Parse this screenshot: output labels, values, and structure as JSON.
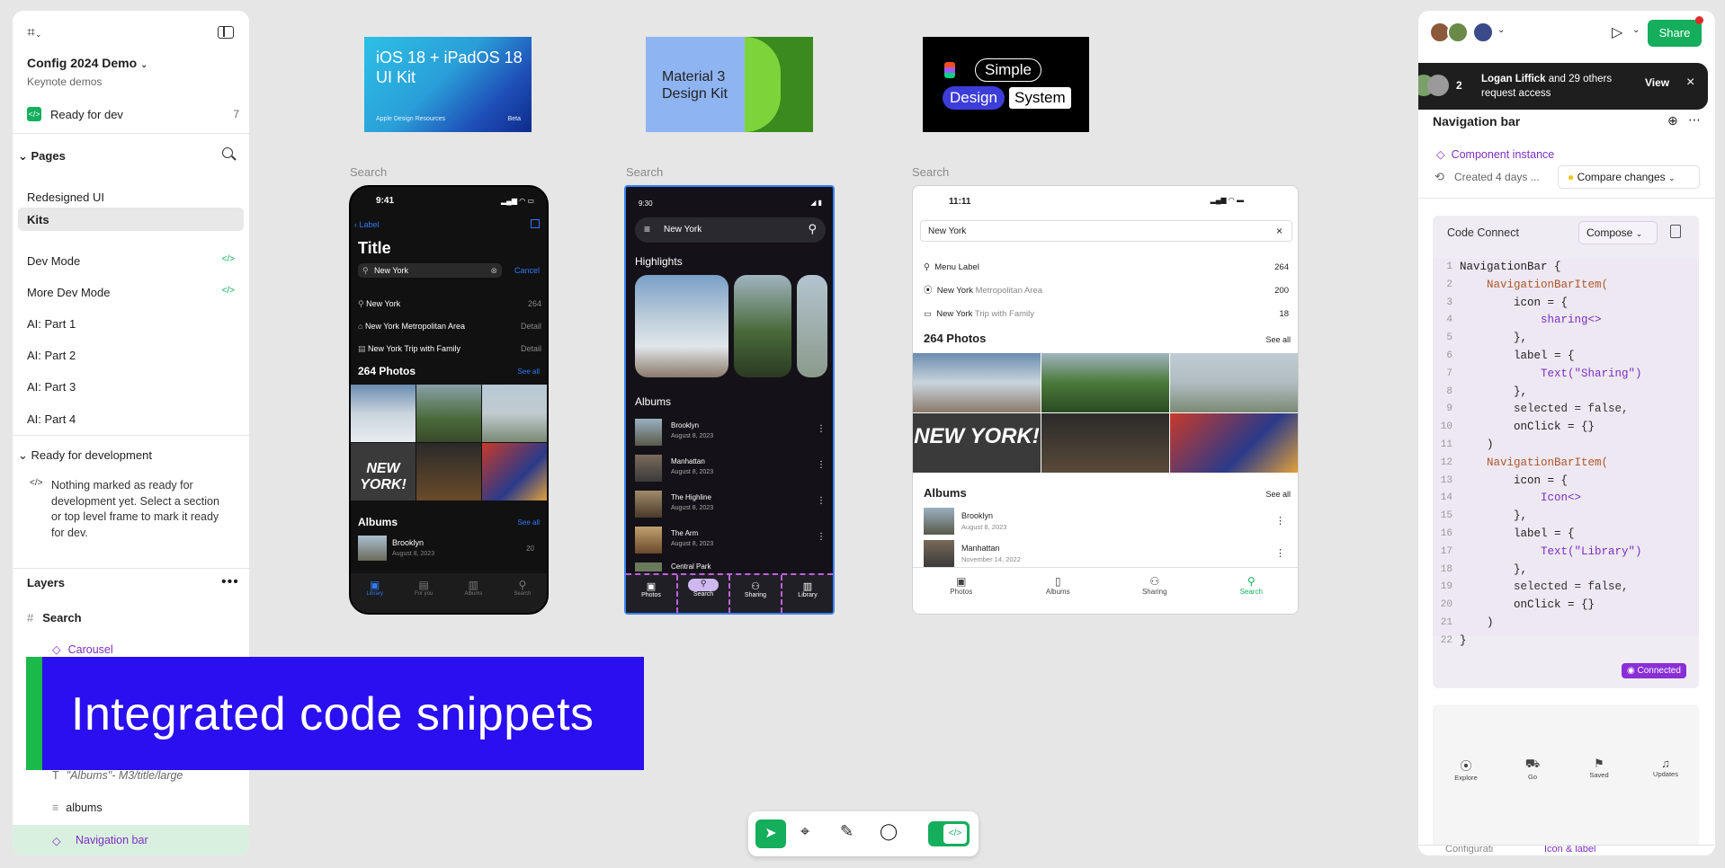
{
  "left": {
    "project_title": "Config 2024 Demo",
    "project_sub": "Keynote demos",
    "ready_label": "Ready for dev",
    "ready_count": "7",
    "pages_header": "Pages",
    "pages": [
      "Redesigned UI",
      "Kits",
      "Dev Mode",
      "More Dev Mode",
      "AI: Part 1",
      "AI: Part 2",
      "AI: Part 3",
      "AI: Part 4"
    ],
    "ready_section": "Ready for development",
    "ready_msg": "Nothing marked as ready for development yet. Select a section or top level frame to mark it ready for dev.",
    "layers_header": "Layers",
    "layers": [
      "Search",
      "Carousel",
      "\"Albums\"- M3/title/large",
      "albums",
      "Navigation bar"
    ]
  },
  "banner": {
    "text": "Integrated code snippets"
  },
  "kits": {
    "ios": {
      "line1": "iOS 18 + iPadOS 18",
      "line2": "UI Kit",
      "foot": "Apple Design Resources",
      "badge": "Beta"
    },
    "material": {
      "line1": "Material 3",
      "line2": "Design Kit"
    },
    "simple": {
      "w1": "Simple",
      "w2": "Design",
      "w3": "System"
    }
  },
  "frame_label": "Search",
  "ios_phone": {
    "time": "9:41",
    "back": "Label",
    "title": "Title",
    "search_value": "New York",
    "cancel": "Cancel",
    "results": [
      {
        "t": "New York",
        "d": "264"
      },
      {
        "t": "New York Metropolitan Area",
        "d": "Detail"
      },
      {
        "t": "New York Trip with Family",
        "d": "Detail"
      }
    ],
    "photos_h": "264 Photos",
    "see_all": "See all",
    "albums_h": "Albums",
    "album1": "Brooklyn",
    "album1_date": "August 8, 2023",
    "album1_count": "20",
    "tabs": [
      "Library",
      "For you",
      "Albums",
      "Search"
    ]
  },
  "m3_phone": {
    "time": "9:30",
    "search_value": "New York",
    "highlights": "Highlights",
    "albums_h": "Albums",
    "albums": [
      {
        "t": "Brooklyn",
        "d": "August 8, 2023"
      },
      {
        "t": "Manhattan",
        "d": "August 8, 2023"
      },
      {
        "t": "The Highline",
        "d": "August 8, 2023"
      },
      {
        "t": "The Arm",
        "d": "August 8, 2023"
      },
      {
        "t": "Central Park",
        "d": ""
      }
    ],
    "nav": [
      "Photos",
      "Search",
      "Sharing",
      "Library"
    ]
  },
  "simple_phone": {
    "time": "11:11",
    "search_value": "New York",
    "results": [
      {
        "t": "Menu Label",
        "sub": "",
        "n": "264"
      },
      {
        "t": "New York",
        "sub": "Metropolitan Area",
        "n": "200"
      },
      {
        "t": "New York",
        "sub": "Trip with Family",
        "n": "18"
      }
    ],
    "photos_h": "264 Photos",
    "see_all": "See all",
    "albums_h": "Albums",
    "albums": [
      {
        "t": "Brooklyn",
        "d": "August 8, 2023"
      },
      {
        "t": "Manhattan",
        "d": "November 14, 2022"
      }
    ],
    "nav": [
      "Photos",
      "Albums",
      "Sharing",
      "Search"
    ]
  },
  "right": {
    "share": "Share",
    "notif_count": "2",
    "notif_name": "Logan Liffick",
    "notif_rest": " and 29 others request access",
    "notif_view": "View",
    "title": "Navigation bar",
    "instance": "Component instance",
    "created": "Created 4 days ...",
    "compare": "Compare changes",
    "code_connect": "Code Connect",
    "compose": "Compose",
    "connected": "Connected",
    "code_lines": [
      "NavigationBar {",
      "    NavigationBarItem(",
      "        icon = {",
      "            sharing<>",
      "        },",
      "        label = {",
      "            Text(\"Sharing\")",
      "        },",
      "        selected = false,",
      "        onClick = {}",
      "    )",
      "    NavigationBarItem(",
      "        icon = {",
      "            Icon<>",
      "        },",
      "        label = {",
      "            Text(\"Library\")",
      "        },",
      "        selected = false,",
      "        onClick = {}",
      "    )",
      "}"
    ],
    "preview_nav": [
      "Explore",
      "Go",
      "Saved",
      "Updates"
    ],
    "bottom_tabs": [
      "Configurati",
      "Icon & label"
    ]
  },
  "colors": {
    "accent": "#0d99ff",
    "green": "#14ae5c",
    "banner": "#2a0ff0",
    "purple": "#7b2fbe"
  }
}
